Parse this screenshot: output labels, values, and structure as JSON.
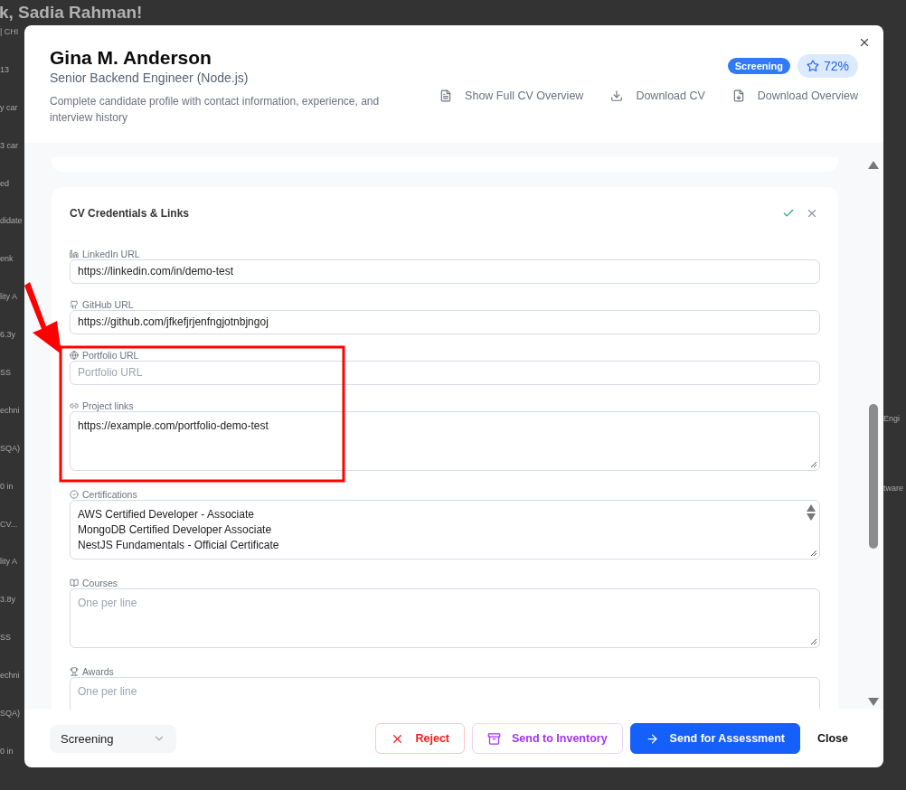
{
  "background": {
    "greeting": "k, Sadia Rahman!",
    "left_fragments": [
      "| CHI",
      "13",
      "y car",
      "3 car",
      "ed",
      "didate",
      "enk",
      "lity A",
      "6.3y",
      "SS",
      "echni",
      "SQA)",
      "0 in",
      "CV...",
      "lity A",
      "3.8y",
      "SS",
      "echni",
      "SQA)",
      "0 in"
    ],
    "right_fragments": [
      "Engi",
      "tware"
    ]
  },
  "modal": {
    "title": "Gina M. Anderson",
    "subtitle": "Senior Backend Engineer (Node.js)",
    "description": "Complete candidate profile with contact information, experience, and interview history",
    "status_badge": "Screening",
    "score": "72%",
    "actions": [
      "Show Full CV Overview",
      "Download CV",
      "Download Overview"
    ]
  },
  "section": {
    "title": "CV Credentials & Links",
    "fields": [
      {
        "kind": "input",
        "label": "LinkedIn URL",
        "value": "https://linkedin.com/in/demo-test"
      },
      {
        "kind": "input",
        "label": "GitHub URL",
        "value": "https://github.com/jfkefjrjenfngjotnbjngoj"
      },
      {
        "kind": "input",
        "label": "Portfolio URL",
        "placeholder": "Portfolio URL"
      },
      {
        "kind": "textarea",
        "label": "Project links",
        "value": "https://example.com/portfolio-demo-test"
      },
      {
        "kind": "list",
        "label": "Certifications",
        "lines": [
          "AWS Certified Developer - Associate",
          "MongoDB Certified Developer Associate",
          "NestJS Fundamentals - Official Certificate"
        ]
      },
      {
        "kind": "textarea",
        "label": "Courses",
        "placeholder": "One per line"
      },
      {
        "kind": "textarea",
        "label": "Awards",
        "placeholder": "One per line"
      }
    ]
  },
  "footer": {
    "status": "Screening",
    "buttons": [
      {
        "kind": "danger",
        "label": "Reject"
      },
      {
        "kind": "secondary",
        "label": "Send to Inventory"
      },
      {
        "kind": "primary",
        "label": "Send for Assessment"
      },
      {
        "kind": "plain",
        "label": "Close"
      }
    ]
  }
}
